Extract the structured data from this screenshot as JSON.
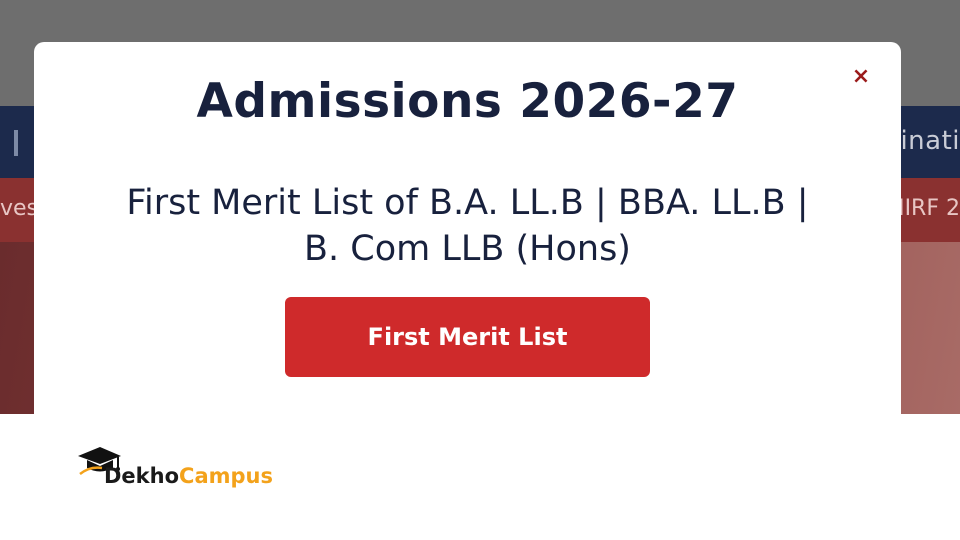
{
  "background": {
    "nav_fragment_right": "inati",
    "ticker_fragment_left": "ves",
    "ticker_fragment_right": "NIRF 2"
  },
  "modal": {
    "close_symbol": "×",
    "title": "Admissions 2026-27",
    "subtitle_line1": "First Merit List of B.A. LL.B | BBA. LL.B |",
    "subtitle_line2": "B. Com LLB (Hons)",
    "button_label": "First Merit List"
  },
  "logo": {
    "icon": "graduation-cap-icon",
    "part1": "Dekho",
    "part2": "Campus"
  },
  "colors": {
    "title": "#18213d",
    "button": "#cf2a2b",
    "close": "#9b1b1b",
    "logo_accent": "#f3a21b"
  }
}
